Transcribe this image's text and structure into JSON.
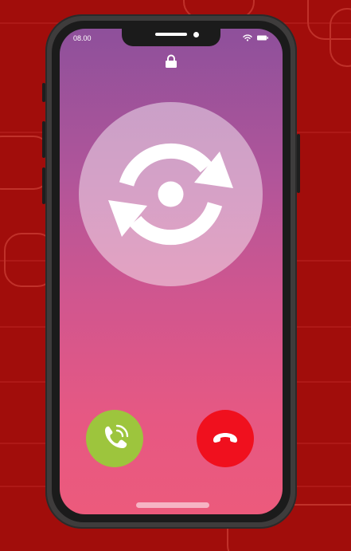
{
  "status_bar": {
    "time": "08.00",
    "wifi_icon": "wifi-icon",
    "battery_icon": "battery-icon"
  },
  "lock_icon": "lock-icon",
  "caller_avatar_icon": "sync-icon",
  "actions": {
    "answer_icon": "phone-answer-icon",
    "decline_icon": "phone-decline-icon"
  },
  "colors": {
    "background": "#a10d0b",
    "answer": "#9dc53d",
    "decline": "#f0101e",
    "screen_top": "#8e509b",
    "screen_bottom": "#ec5a7c"
  }
}
